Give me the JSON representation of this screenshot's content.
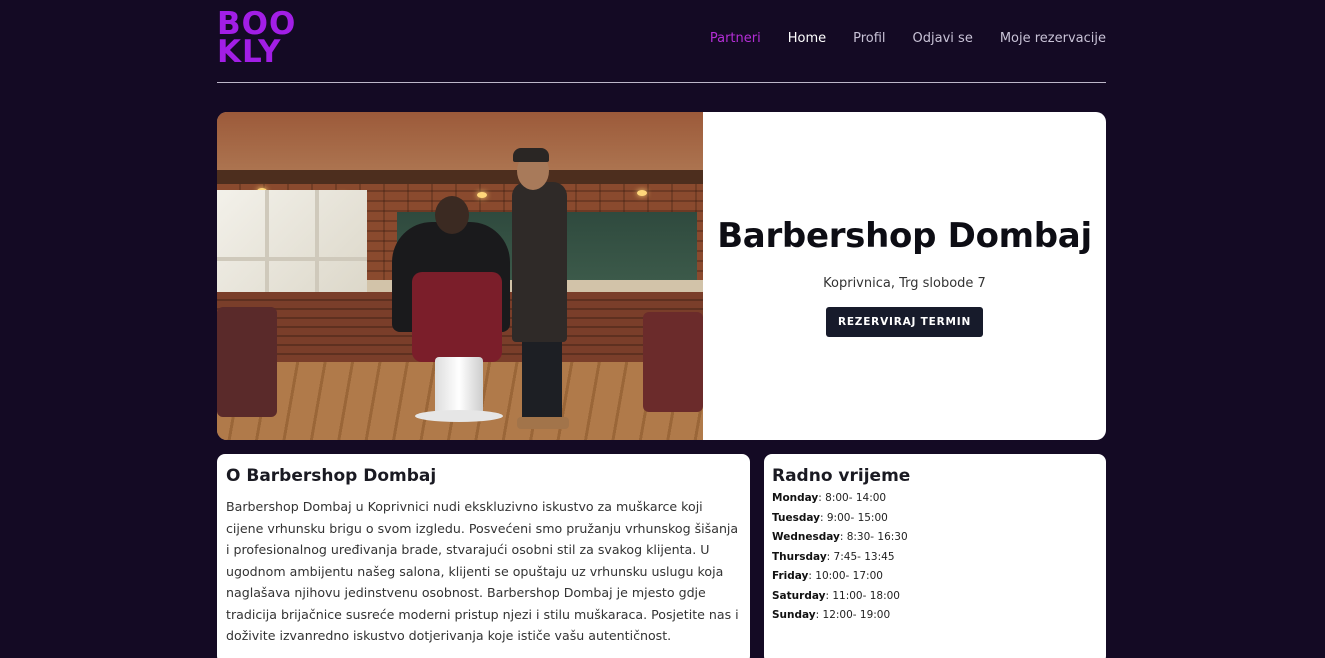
{
  "header": {
    "logo_line1": "BOO",
    "logo_line2": "KLY",
    "nav": [
      {
        "label": "Partneri",
        "active": true
      },
      {
        "label": "Home"
      },
      {
        "label": "Profil"
      },
      {
        "label": "Odjavi se"
      },
      {
        "label": "Moje rezervacije"
      }
    ]
  },
  "hero": {
    "title": "Barbershop Dombaj",
    "address": "Koprivnica, Trg slobode 7",
    "button_label": "REZERVIRAJ TERMIN"
  },
  "about": {
    "title": "O Barbershop Dombaj",
    "text": "Barbershop Dombaj u Koprivnici nudi ekskluzivno iskustvo za muškarce koji cijene vrhunsku brigu o svom izgledu. Posvećeni smo pružanju vrhunskog šišanja i profesionalnog uređivanja brade, stvarajući osobni stil za svakog klijenta. U ugodnom ambijentu našeg salona, klijenti se opuštaju uz vrhunsku uslugu koja naglašava njihovu jedinstvenu osobnost. Barbershop Dombaj je mjesto gdje tradicija brijačnice susreće moderni pristup njezi i stilu muškaraca. Posjetite nas i doživite izvanredno iskustvo dotjerivanja koje ističe vašu autentičnost."
  },
  "hours": {
    "title": "Radno vrijeme",
    "days": [
      {
        "day": "Monday",
        "time": ": 8:00- 14:00"
      },
      {
        "day": "Tuesday",
        "time": ": 9:00- 15:00"
      },
      {
        "day": "Wednesday",
        "time": ": 8:30- 16:30"
      },
      {
        "day": "Thursday",
        "time": ": 7:45- 13:45"
      },
      {
        "day": "Friday",
        "time": ": 10:00- 17:00"
      },
      {
        "day": "Saturday",
        "time": ": 11:00- 18:00"
      },
      {
        "day": "Sunday",
        "time": ": 12:00- 19:00"
      }
    ]
  },
  "colors": {
    "background": "#140a24",
    "brand": "#a21ee6",
    "nav_active": "#b42ed6",
    "button_bg": "#171b2b"
  }
}
